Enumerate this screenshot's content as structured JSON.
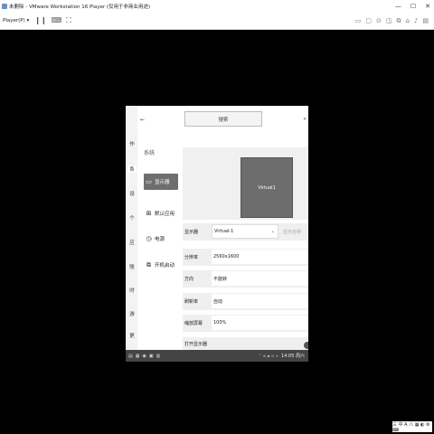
{
  "window": {
    "title": "未删除 - VMware Workstation 16 Player (仅用于非商业用途)",
    "controls": [
      "—",
      "☐",
      "✕"
    ]
  },
  "toolbar": {
    "player_menu": "Player(P) ▾",
    "icons": [
      "pause-icon",
      "send-keys-icon",
      "fullscreen-icon"
    ],
    "right_icons": [
      "▭",
      "▢",
      "⊙",
      "◫",
      "⧉",
      "⌂",
      "♪",
      "▤"
    ]
  },
  "vm": {
    "left_strip": {
      "items": [
        "作",
        "系",
        "设",
        "个",
        "应",
        "账",
        "时",
        "游",
        "更"
      ]
    },
    "nav": {
      "back": "←",
      "section_title": "系统",
      "items": [
        {
          "icon": "monitor-icon",
          "label": "显示器",
          "active": true
        },
        {
          "icon": "apps-icon",
          "label": "默认应用",
          "active": false
        },
        {
          "icon": "power-icon",
          "label": "电源",
          "active": false
        },
        {
          "icon": "startup-icon",
          "label": "开机启动",
          "active": false
        }
      ]
    },
    "search": {
      "placeholder": "搜索"
    },
    "top_right": "×",
    "preview": {
      "monitor_label": "Virtual1"
    },
    "settings": {
      "display_label": "显示器",
      "display_value": "Virtual-1",
      "identify_label": "显示名称",
      "resolution_label": "分辨率",
      "resolution_value": "2560x1600",
      "orientation_label": "方向",
      "orientation_value": "不旋转",
      "refresh_label": "刷新率",
      "refresh_value": "自动",
      "scale_label": "缩放屏幕",
      "scale_value": "100%",
      "open_label": "打开显示器"
    },
    "taskbar": {
      "left_icons": [
        "▤",
        "▦",
        "◉",
        "▣",
        "▥"
      ],
      "tray_icons": "⌃ ⊕ ◉ ⊟ ≡",
      "time": "14:05 周六"
    }
  },
  "corner": {
    "text": "三 中 A 八 ▦ ◐ ⚙ ⌨"
  }
}
